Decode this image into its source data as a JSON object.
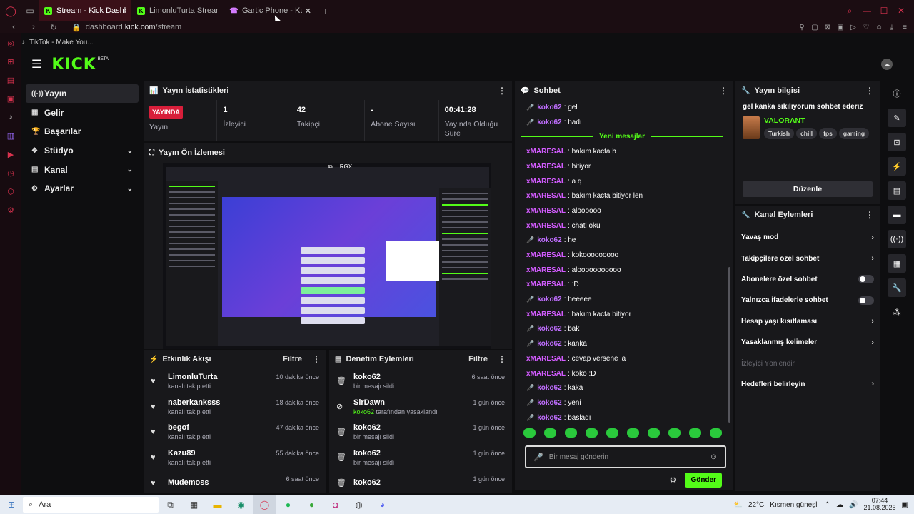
{
  "browser": {
    "tabs": [
      {
        "title": "Stream - Kick Dashboard",
        "active": true,
        "favicon_color": "#53fc18",
        "favicon": "K"
      },
      {
        "title": "LimonluTurta Stream - W",
        "active": false,
        "favicon_color": "#53fc18",
        "favicon": "K"
      },
      {
        "title": "Gartic Phone - Kulakt",
        "active": false,
        "favicon_color": "#d57cff",
        "favicon": "☎"
      }
    ],
    "new_tab": "+",
    "url_prefix": "dashboard.",
    "url_domain": "kick.com",
    "url_path": "/stream",
    "bookmark": "TikTok - Make You..."
  },
  "kick": {
    "logo": "KICK",
    "beta": "BETA"
  },
  "leftnav": {
    "items": [
      {
        "label": "Yayın",
        "icon": "broadcast-icon",
        "glyph": "((·))",
        "active": true,
        "chevron": false
      },
      {
        "label": "Gelir",
        "icon": "revenue-icon",
        "glyph": "▦",
        "active": false,
        "chevron": false
      },
      {
        "label": "Başarılar",
        "icon": "trophy-icon",
        "glyph": "🏆",
        "active": false,
        "chevron": false
      },
      {
        "label": "Stüdyo",
        "icon": "studio-icon",
        "glyph": "❖",
        "active": false,
        "chevron": true
      },
      {
        "label": "Kanal",
        "icon": "channel-icon",
        "glyph": "▤",
        "active": false,
        "chevron": true
      },
      {
        "label": "Ayarlar",
        "icon": "settings-icon",
        "glyph": "⚙",
        "active": false,
        "chevron": true
      }
    ]
  },
  "stats": {
    "title": "Yayın İstatistikleri",
    "live_badge": "YAYINDA",
    "live_label": "Yayın",
    "items": [
      {
        "value": "1",
        "label": "İzleyici"
      },
      {
        "value": "42",
        "label": "Takipçi"
      },
      {
        "value": "-",
        "label": "Abone Sayısı"
      },
      {
        "value": "00:41:28",
        "label": "Yayında Olduğu Süre"
      }
    ]
  },
  "preview": {
    "title": "Yayın Ön İzlemesi",
    "btn_copy": "⧉",
    "btn_rgx": "RGX"
  },
  "activity": {
    "title": "Etkinlik Akışı",
    "filter": "Filtre",
    "rows": [
      {
        "name": "LimonluTurta",
        "sub": "kanalı takip etti",
        "time": "10 dakika önce"
      },
      {
        "name": "naberkanksss",
        "sub": "kanalı takip etti",
        "time": "18 dakika önce"
      },
      {
        "name": "begof",
        "sub": "kanalı takip etti",
        "time": "47 dakika önce"
      },
      {
        "name": "Kazu89",
        "sub": "kanalı takip etti",
        "time": "55 dakika önce"
      },
      {
        "name": "Mudemoss",
        "sub": "",
        "time": "6 saat önce"
      }
    ]
  },
  "moderation": {
    "title": "Denetim Eylemleri",
    "filter": "Filtre",
    "rows": [
      {
        "name": "koko62",
        "sub": "bir mesajı sildi",
        "sub_pre": "",
        "time": "6 saat önce",
        "icon": "trash-icon",
        "glyph": "🗑"
      },
      {
        "name": "SirDawn",
        "sub": " tarafından yasaklandı",
        "sub_pre": "koko62",
        "time": "1 gün önce",
        "icon": "ban-icon",
        "glyph": "⊘"
      },
      {
        "name": "koko62",
        "sub": "bir mesajı sildi",
        "sub_pre": "",
        "time": "1 gün önce",
        "icon": "trash-icon",
        "glyph": "🗑"
      },
      {
        "name": "koko62",
        "sub": "bir mesajı sildi",
        "sub_pre": "",
        "time": "1 gün önce",
        "icon": "trash-icon",
        "glyph": "🗑"
      },
      {
        "name": "koko62",
        "sub": "",
        "sub_pre": "",
        "time": "1 gün önce",
        "icon": "trash-icon",
        "glyph": "🗑"
      }
    ]
  },
  "chat": {
    "title": "Sohbet",
    "new_messages": "Yeni mesajlar",
    "before": [
      {
        "user": "koko62",
        "text": "gel",
        "mic": true
      },
      {
        "user": "koko62",
        "text": "hadı",
        "mic": true
      }
    ],
    "after": [
      {
        "user": "xMARESAL",
        "text": "bakım kacta b",
        "mic": false
      },
      {
        "user": "xMARESAL",
        "text": "bitiyor",
        "mic": false
      },
      {
        "user": "xMARESAL",
        "text": "a q",
        "mic": false
      },
      {
        "user": "xMARESAL",
        "text": "bakım kacta bitiyor len",
        "mic": false
      },
      {
        "user": "xMARESAL",
        "text": "aloooooo",
        "mic": false
      },
      {
        "user": "xMARESAL",
        "text": "chati oku",
        "mic": false
      },
      {
        "user": "koko62",
        "text": "he",
        "mic": true
      },
      {
        "user": "xMARESAL",
        "text": "kokooooooooo",
        "mic": false
      },
      {
        "user": "xMARESAL",
        "text": "alooooooooooo",
        "mic": false
      },
      {
        "user": "xMARESAL",
        "text": ":D",
        "mic": false
      },
      {
        "user": "koko62",
        "text": "heeeee",
        "mic": true
      },
      {
        "user": "xMARESAL",
        "text": "bakım kacta bitiyor",
        "mic": false
      },
      {
        "user": "koko62",
        "text": "bak",
        "mic": true
      },
      {
        "user": "koko62",
        "text": "kanka",
        "mic": true
      },
      {
        "user": "xMARESAL",
        "text": "cevap versene la",
        "mic": false
      },
      {
        "user": "xMARESAL",
        "text": "koko :D",
        "mic": false
      },
      {
        "user": "koko62",
        "text": "kaka",
        "mic": true
      },
      {
        "user": "koko62",
        "text": "yeni",
        "mic": true
      },
      {
        "user": "koko62",
        "text": "basladı",
        "mic": true
      }
    ],
    "input_placeholder": "Bir mesaj gönderin",
    "send": "Gönder"
  },
  "info": {
    "title": "Yayın bilgisi",
    "stream_title": "gel kanka sıkılıyorum sohbet ederız",
    "game": "VALORANT",
    "tags": [
      "Turkish",
      "chill",
      "fps",
      "gaming"
    ],
    "edit": "Düzenle"
  },
  "channel_actions": {
    "title": "Kanal Eylemleri",
    "rows": [
      {
        "label": "Yavaş mod",
        "kind": "chevron"
      },
      {
        "label": "Takipçilere özel sohbet",
        "kind": "chevron"
      },
      {
        "label": "Abonelere özel sohbet",
        "kind": "toggle"
      },
      {
        "label": "Yalnızca ifadelerle sohbet",
        "kind": "toggle"
      },
      {
        "label": "Hesap yaşı kısıtlaması",
        "kind": "chevron"
      },
      {
        "label": "Yasaklanmış kelimeler",
        "kind": "chevron"
      },
      {
        "label": "İzleyici Yönlendir",
        "kind": "disabled"
      },
      {
        "label": "Hedefleri belirleyin",
        "kind": "chevron"
      }
    ]
  },
  "taskbar": {
    "search_placeholder": "Ara",
    "weather": "22°C",
    "weather_desc": "Kısmen güneşli",
    "time": "07:44",
    "date": "21.08.2025"
  },
  "colors": {
    "kick_green": "#53fc18",
    "live_red": "#d81e3a",
    "panel": "#18181b",
    "background": "#0e0e10"
  }
}
